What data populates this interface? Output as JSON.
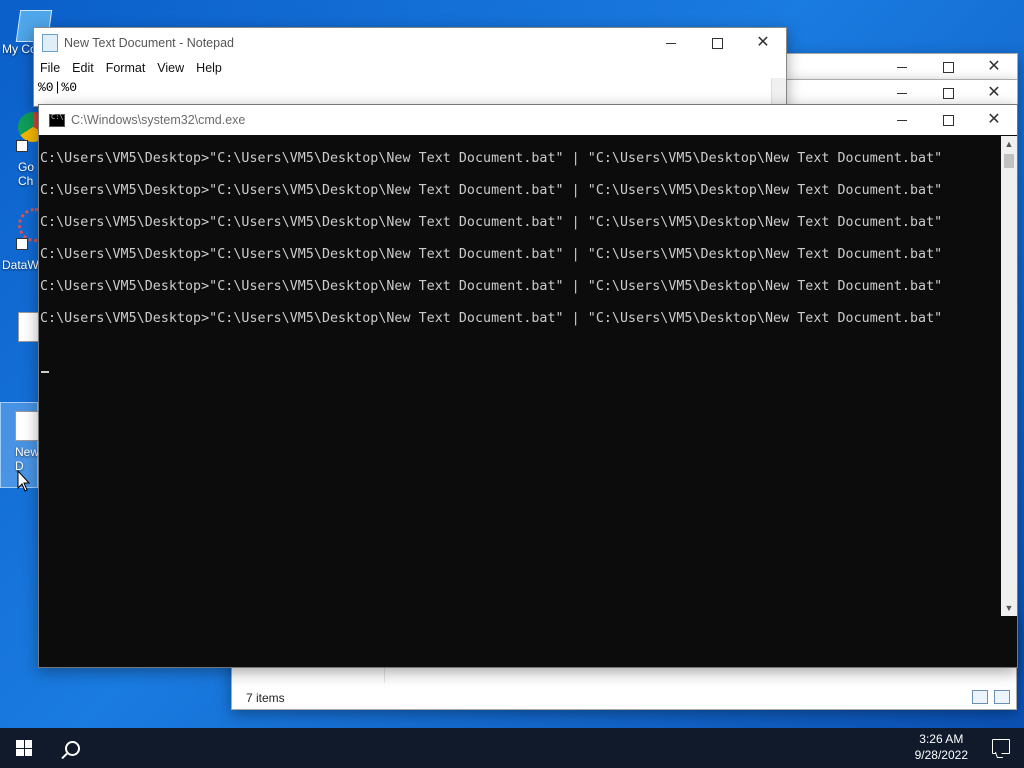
{
  "desktop": {
    "icons": [
      {
        "label": "My Co"
      },
      {
        "label": "Go\nCh"
      },
      {
        "label": "DataW"
      },
      {
        "label": ""
      },
      {
        "label": "New\nD"
      }
    ]
  },
  "notepad": {
    "title": "New Text Document - Notepad",
    "menu": [
      "File",
      "Edit",
      "Format",
      "View",
      "Help"
    ],
    "content": "%0|%0"
  },
  "cmd": {
    "title": "C:\\Windows\\system32\\cmd.exe",
    "lines": [
      "C:\\Users\\VM5\\Desktop>\"C:\\Users\\VM5\\Desktop\\New Text Document.bat\" | \"C:\\Users\\VM5\\Desktop\\New Text Document.bat\"",
      "C:\\Users\\VM5\\Desktop>\"C:\\Users\\VM5\\Desktop\\New Text Document.bat\" | \"C:\\Users\\VM5\\Desktop\\New Text Document.bat\"",
      "C:\\Users\\VM5\\Desktop>\"C:\\Users\\VM5\\Desktop\\New Text Document.bat\" | \"C:\\Users\\VM5\\Desktop\\New Text Document.bat\"",
      "C:\\Users\\VM5\\Desktop>\"C:\\Users\\VM5\\Desktop\\New Text Document.bat\" | \"C:\\Users\\VM5\\Desktop\\New Text Document.bat\"",
      "C:\\Users\\VM5\\Desktop>\"C:\\Users\\VM5\\Desktop\\New Text Document.bat\" | \"C:\\Users\\VM5\\Desktop\\New Text Document.bat\"",
      "C:\\Users\\VM5\\Desktop>\"C:\\Users\\VM5\\Desktop\\New Text Document.bat\" | \"C:\\Users\\VM5\\Desktop\\New Text Document.bat\""
    ]
  },
  "explorer": {
    "status": "7 items"
  },
  "taskbar": {
    "time": "3:26 AM",
    "date": "9/28/2022"
  },
  "icons": {
    "start": "windows-logo-icon",
    "search": "search-icon",
    "notifications": "notification-icon"
  }
}
